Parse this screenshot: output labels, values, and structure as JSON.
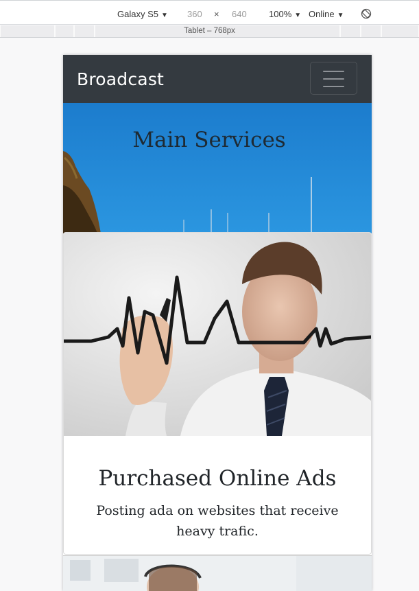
{
  "devtools": {
    "device": "Galaxy S5",
    "width": "360",
    "times": "×",
    "height": "640",
    "zoom": "100%",
    "network": "Online",
    "media_query_label": "Tablet – 768px"
  },
  "navbar": {
    "brand": "Broadcast",
    "toggler_icon": "hamburger-icon"
  },
  "hero": {
    "title": "Main Services"
  },
  "card": {
    "title": "Purchased Online Ads",
    "text": "Posting ada on websites that receive heavy trafic."
  }
}
